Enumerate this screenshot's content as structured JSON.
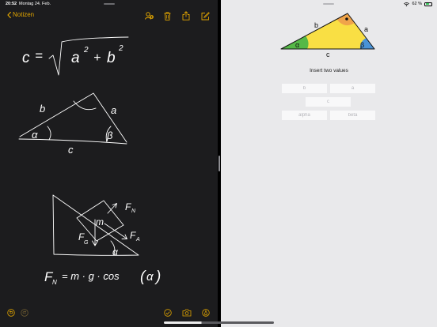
{
  "status_bar": {
    "time": "20:52",
    "date": "Montag 24. Feb.",
    "battery": "62 %",
    "battery_level": 0.62
  },
  "notes": {
    "back_label": "Notizen",
    "accent_color": "#e0a400",
    "toolbar_icons": [
      "share-contact-icon",
      "trash-icon",
      "share-icon",
      "compose-icon"
    ],
    "bottom_icons": [
      "undo-icon",
      "redo-icon",
      "checklist-icon",
      "camera-icon",
      "pen-icon"
    ],
    "handwriting": {
      "formula_1": {
        "lhs": "c",
        "eq": "=",
        "a": "a",
        "exp_a": "2",
        "plus": "+",
        "b": "b",
        "exp_b": "2"
      },
      "triangle_1": {
        "side_b": "b",
        "side_a": "a",
        "side_c": "c",
        "angle_alpha": "α",
        "angle_beta": "β"
      },
      "incline": {
        "mass": "m",
        "fn": "F",
        "fn_sub": "N",
        "fg": "F",
        "fg_sub": "G",
        "fa": "F",
        "fa_sub": "A",
        "angle": "α"
      },
      "formula_2": {
        "f": "F",
        "f_sub": "N",
        "rhs": "= m · g · cos",
        "paren_open": "(",
        "alpha": "α",
        "paren_close": ")"
      }
    }
  },
  "calculator": {
    "triangle": {
      "label_b": "b",
      "label_a": "a",
      "label_c": "c",
      "label_alpha": "α",
      "label_beta": "β",
      "colors": {
        "fill": "#f9df44",
        "alpha": "#55b947",
        "beta": "#4a93d7",
        "right_angle": "#f0a44a",
        "stroke": "#111111"
      }
    },
    "instruction": "Insert two values",
    "inputs": {
      "a": "a",
      "b": "b",
      "c": "c",
      "alpha": "alpha",
      "beta": "beta"
    }
  }
}
